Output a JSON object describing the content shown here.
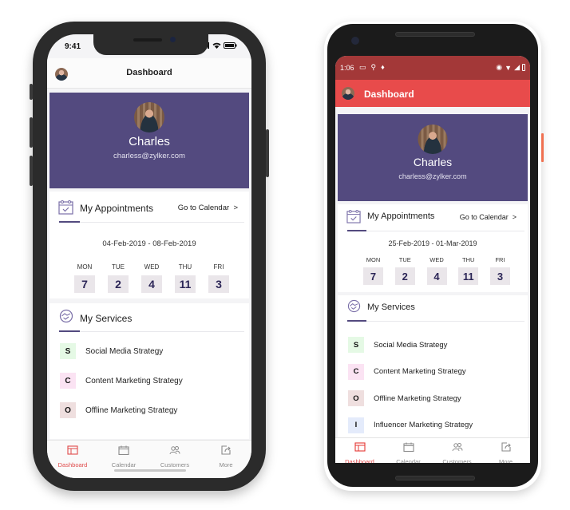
{
  "ios": {
    "status": {
      "time": "9:41"
    },
    "header": {
      "title": "Dashboard"
    },
    "profile": {
      "name": "Charles",
      "email": "charless@zylker.com"
    },
    "appointments": {
      "title": "My Appointments",
      "goto_label": "Go to Calendar  >",
      "date_range": "04-Feb-2019 - 08-Feb-2019",
      "days": [
        {
          "label": "MON",
          "count": "7"
        },
        {
          "label": "TUE",
          "count": "2"
        },
        {
          "label": "WED",
          "count": "4"
        },
        {
          "label": "THU",
          "count": "11"
        },
        {
          "label": "FRI",
          "count": "3"
        }
      ]
    },
    "services": {
      "title": "My Services",
      "items": [
        {
          "initial": "S",
          "label": "Social Media Strategy",
          "color": "#e5f9e5"
        },
        {
          "initial": "C",
          "label": "Content Marketing Strategy",
          "color": "#fbe3f3"
        },
        {
          "initial": "O",
          "label": "Offline Marketing Strategy",
          "color": "#efdfdf"
        }
      ]
    },
    "tabs": [
      {
        "label": "Dashboard",
        "icon": "dashboard-icon",
        "active": true
      },
      {
        "label": "Calendar",
        "icon": "calendar-icon",
        "active": false
      },
      {
        "label": "Customers",
        "icon": "customers-icon",
        "active": false
      },
      {
        "label": "More",
        "icon": "share-icon",
        "active": false
      }
    ]
  },
  "android": {
    "status": {
      "time": "1:06"
    },
    "header": {
      "title": "Dashboard"
    },
    "profile": {
      "name": "Charles",
      "email": "charless@zylker.com"
    },
    "appointments": {
      "title": "My Appointments",
      "goto_label": "Go to Calendar  >",
      "date_range": "25-Feb-2019 - 01-Mar-2019",
      "days": [
        {
          "label": "MON",
          "count": "7"
        },
        {
          "label": "TUE",
          "count": "2"
        },
        {
          "label": "WED",
          "count": "4"
        },
        {
          "label": "THU",
          "count": "11"
        },
        {
          "label": "FRI",
          "count": "3"
        }
      ]
    },
    "services": {
      "title": "My Services",
      "items": [
        {
          "initial": "S",
          "label": "Social Media Strategy",
          "color": "#e5f9e5"
        },
        {
          "initial": "C",
          "label": "Content Marketing Strategy",
          "color": "#fbe3f3"
        },
        {
          "initial": "O",
          "label": "Offline Marketing Strategy",
          "color": "#efdfdf"
        },
        {
          "initial": "I",
          "label": "Influencer Marketing Strategy",
          "color": "#e4ebfb"
        }
      ]
    },
    "tabs": [
      {
        "label": "Dashboard",
        "icon": "dashboard-icon",
        "active": true
      },
      {
        "label": "Calendar",
        "icon": "calendar-icon",
        "active": false
      },
      {
        "label": "Customers",
        "icon": "customers-icon",
        "active": false
      },
      {
        "label": "More",
        "icon": "share-icon",
        "active": false
      }
    ]
  },
  "colors": {
    "primary": "#534a7f",
    "accent_red": "#e84b4b",
    "status_red": "#a33838",
    "inactive": "#8a8a8a"
  }
}
